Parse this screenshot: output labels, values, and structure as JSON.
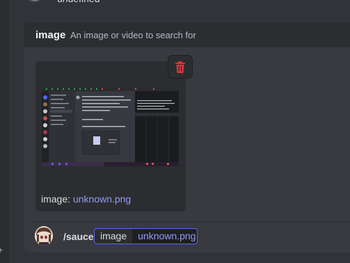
{
  "previous_message": {
    "text": "undefined"
  },
  "option_header": {
    "name": "image",
    "description": "An image or video to search for"
  },
  "attachment": {
    "caption_prefix": "image:",
    "filename": "unknown.png"
  },
  "command_input": {
    "command": "/sauce",
    "option_name": "image",
    "option_value": "unknown.png"
  },
  "colors": {
    "background": "#313338",
    "panel": "#383a40",
    "header": "#2b2d31",
    "link": "#949cf7",
    "danger": "#da373c",
    "accent": "#5865f2"
  }
}
